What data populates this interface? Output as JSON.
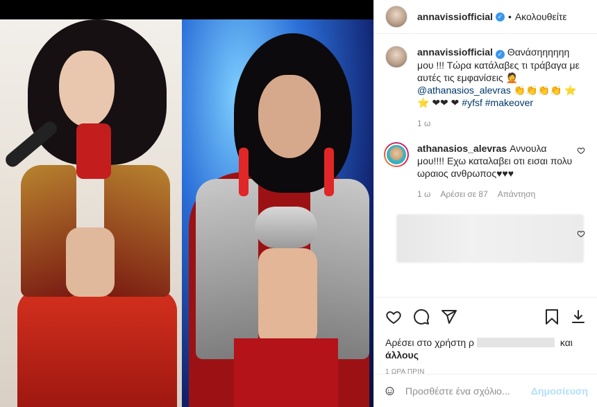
{
  "header": {
    "username": "annavissiofficial",
    "separator": "•",
    "follow_label": "Ακολουθείτε"
  },
  "caption": {
    "username": "annavissiofficial",
    "text_main": "Θανάσηηηηηη μου !!! Τώρα κατάλαβες τι τράβαγα με αυτές τις εμφανίσεις 🤦",
    "mention": "@athanasios_alevras",
    "emoji_run": " 👏👏👏👏 ⭐ ⭐ ❤❤ ❤ ",
    "hashtag_1": "#yfsf",
    "hashtag_2": "#makeover",
    "time": "1 ω"
  },
  "comment_1": {
    "username": "athanasios_alevras",
    "text": " Αννουλα μου!!!! Εχω καταλαβει οτι εισαι πολυ ωραιος ανθρωπος♥♥♥",
    "time": "1 ω",
    "likes": "Αρέσει σε 87",
    "reply": "Απάντηση"
  },
  "likes_line": {
    "prefix": "Αρέσει στο χρήστη ρ",
    "suffix": " και",
    "others": "άλλους"
  },
  "timestamp": "1 ΩΡΑ ΠΡΙΝ",
  "add_comment": {
    "placeholder": "Προσθέστε ένα σχόλιο...",
    "post_label": "Δημοσίευση"
  },
  "icons": {
    "verified": "verified-badge-icon",
    "like": "heart-icon",
    "comment": "comment-bubble-icon",
    "share": "paper-plane-icon",
    "save": "bookmark-icon",
    "download": "download-icon",
    "emoji": "smiley-icon"
  },
  "colors": {
    "link": "#00376b",
    "verified": "#3897f0",
    "post_disabled": "#b2dffc",
    "muted": "#8e8e8e"
  }
}
